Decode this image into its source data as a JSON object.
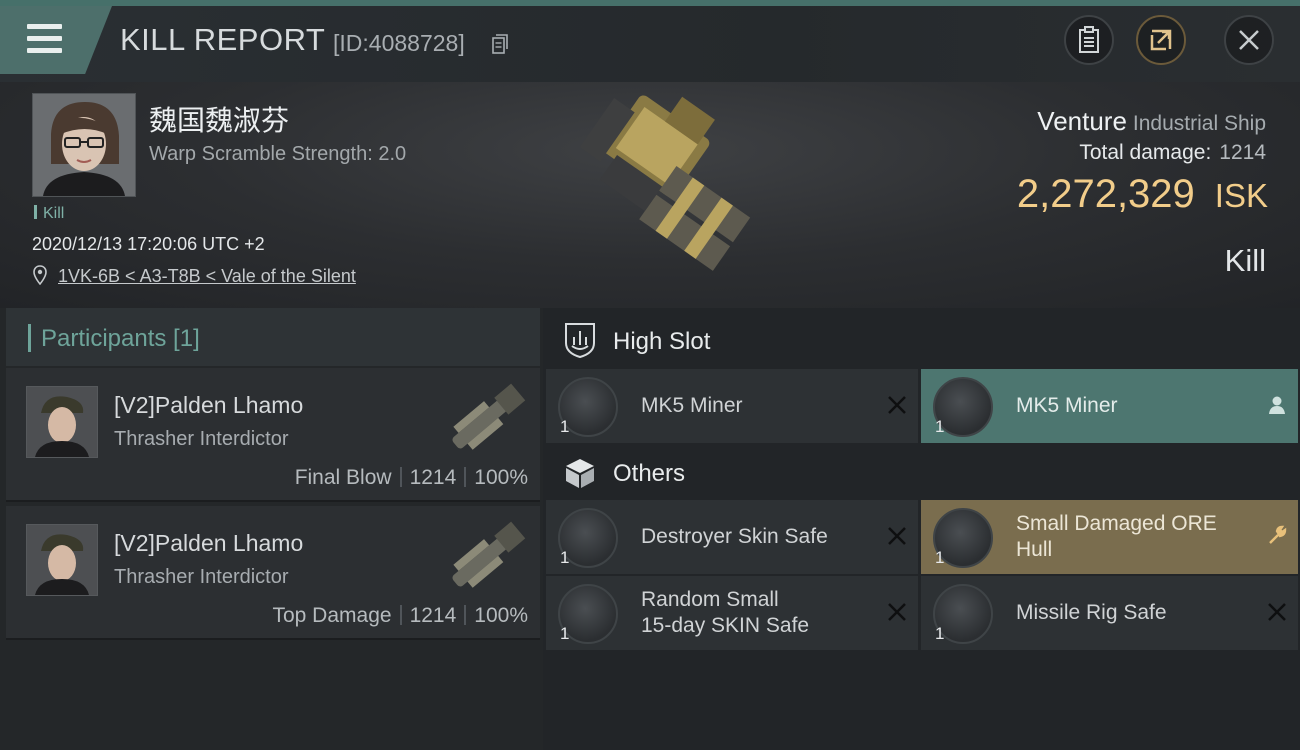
{
  "header": {
    "title": "KILL REPORT",
    "report_id": "[ID:4088728]"
  },
  "victim": {
    "name": "魏国魏淑芬",
    "warp_scramble": "Warp Scramble Strength: 2.0",
    "tag": "Kill",
    "datetime": "2020/12/13 17:20:06 UTC +2",
    "location": "1VK-6B < A3-T8B < Vale of the Silent"
  },
  "ship": {
    "name": "Venture",
    "class": "Industrial Ship",
    "total_damage_label": "Total damage:",
    "total_damage": "1214",
    "value": "2,272,329",
    "currency": "ISK",
    "kind": "Kill"
  },
  "participants": {
    "title": "Participants [1]",
    "rows": [
      {
        "name": "[V2]Palden Lhamo",
        "ship": "Thrasher Interdictor",
        "label": "Final Blow",
        "damage": "1214",
        "percent": "100%"
      },
      {
        "name": "[V2]Palden Lhamo",
        "ship": "Thrasher Interdictor",
        "label": "Top Damage",
        "damage": "1214",
        "percent": "100%"
      }
    ]
  },
  "sections": {
    "high_slot": "High Slot",
    "others": "Others"
  },
  "high_slot_items": [
    {
      "name": "MK5 Miner",
      "qty": "1",
      "state": "destroyed",
      "action": "close-icon"
    },
    {
      "name": "MK5 Miner",
      "qty": "1",
      "state": "fitted",
      "action": "person-icon"
    }
  ],
  "other_items": [
    {
      "name": "Destroyer Skin Safe",
      "qty": "1",
      "state": "destroyed"
    },
    {
      "name_line1": "Small Damaged ORE",
      "name_line2": "Hull",
      "qty": "1",
      "state": "dropped",
      "action": "wrench-icon"
    },
    {
      "name_line1": "Random Small",
      "name_line2": "15-day SKIN Safe",
      "qty": "1",
      "state": "destroyed"
    },
    {
      "name": "Missile Rig Safe",
      "qty": "1",
      "state": "destroyed"
    }
  ],
  "colors": {
    "accent": "#4d6f6b",
    "isk": "#f2cd8a",
    "fitted_bg": "#4d7670",
    "dropped_bg": "#7a6d4e",
    "participant_title": "#6ea49a"
  }
}
